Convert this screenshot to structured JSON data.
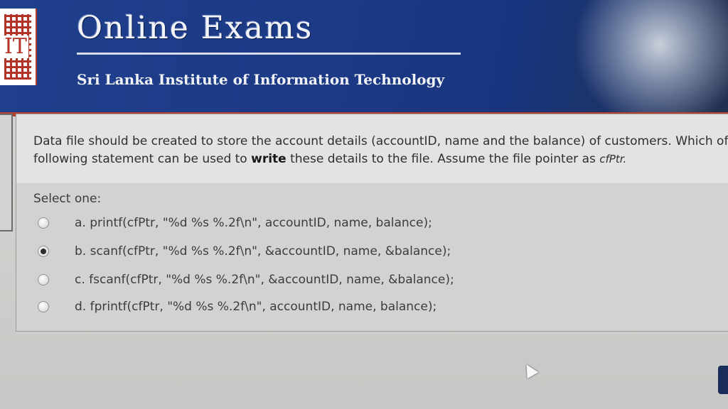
{
  "header": {
    "logo_text": "IT",
    "title": "Online Exams",
    "subtitle": "Sri Lanka Institute of Information Technology"
  },
  "question": {
    "text_part1": "Data file should be created to store the account details (accountID, name and the balance) of customers. Which of following statement can be used to ",
    "text_bold": "write",
    "text_part2": " these details to the file. Assume the file pointer as ",
    "text_italic": "cfPtr."
  },
  "answer": {
    "prompt": "Select one:",
    "options": [
      {
        "label": "a. printf(cfPtr, \"%d %s %.2f\\n\", accountID, name, balance);",
        "selected": false
      },
      {
        "label": "b. scanf(cfPtr, \"%d %s %.2f\\n\", &accountID, name, &balance);",
        "selected": true
      },
      {
        "label": "c. fscanf(cfPtr, \"%d %s %.2f\\n\", &accountID, name, &balance);",
        "selected": false
      },
      {
        "label": "d. fprintf(cfPtr, \"%d %s %.2f\\n\", accountID, name, balance);",
        "selected": false
      }
    ]
  },
  "colors": {
    "header_blue": "#1f3f8c",
    "header_accent": "#b6412f",
    "panel": "#e3e4e1"
  },
  "icons": {
    "cursor": "mouse-pointer-icon",
    "logo": "sliit-logo-icon"
  }
}
